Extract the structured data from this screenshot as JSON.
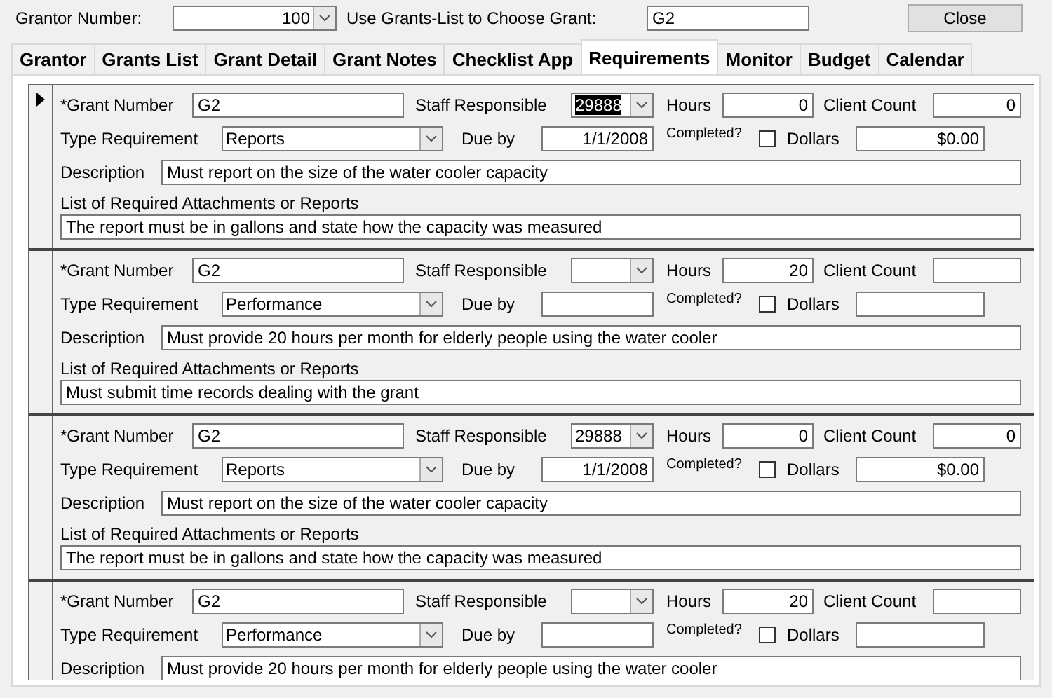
{
  "header": {
    "grantor_label": "Grantor Number:",
    "grantor_value": "100",
    "grant_label": "Use Grants-List to Choose Grant:",
    "grant_value": "G2",
    "close_button": "Close"
  },
  "tabs": [
    {
      "label": "Grantor",
      "selected": false
    },
    {
      "label": "Grants List",
      "selected": false
    },
    {
      "label": "Grant Detail",
      "selected": false
    },
    {
      "label": "Grant Notes",
      "selected": false
    },
    {
      "label": "Checklist App",
      "selected": false
    },
    {
      "label": "Requirements",
      "selected": true
    },
    {
      "label": "Monitor",
      "selected": false
    },
    {
      "label": "Budget",
      "selected": false
    },
    {
      "label": "Calendar",
      "selected": false
    }
  ],
  "records": [
    {
      "current": true,
      "grant_number_label": "*Grant Number",
      "grant_number": "G2",
      "staff_label": "Staff Responsible",
      "staff": "29888",
      "staff_focused": true,
      "hours_label": "Hours",
      "hours": "0",
      "client_count_label": "Client Count",
      "client_count": "0",
      "type_label": "Type Requirement",
      "type": "Reports",
      "due_by_label": "Due by",
      "due_by": "1/1/2008",
      "completed_label": "Completed?",
      "completed": false,
      "dollars_label": "Dollars",
      "dollars": "$0.00",
      "description_label": "Description",
      "description": "Must report on the size of the water cooler capacity",
      "attachments_label": "List of Required Attachments or Reports",
      "attachments": "The report must be in gallons and state how the capacity was measured"
    },
    {
      "current": false,
      "grant_number_label": "*Grant Number",
      "grant_number": "G2",
      "staff_label": "Staff Responsible",
      "hours_label": "Hours",
      "hours": "20",
      "client_count_label": "Client Count",
      "type_label": "Type Requirement",
      "type": "Performance",
      "due_by_label": "Due by",
      "completed_label": "Completed?",
      "completed": false,
      "dollars_label": "Dollars",
      "description_label": "Description",
      "description": "Must provide 20 hours per month for elderly people using the water cooler",
      "attachments_label": "List of Required Attachments or Reports",
      "attachments": "Must submit time records dealing with the grant"
    },
    {
      "current": false,
      "grant_number_label": "*Grant Number",
      "grant_number": "G2",
      "staff_label": "Staff Responsible",
      "staff": "29888",
      "staff_focused": false,
      "hours_label": "Hours",
      "hours": "0",
      "client_count_label": "Client Count",
      "client_count": "0",
      "type_label": "Type Requirement",
      "type": "Reports",
      "due_by_label": "Due by",
      "due_by": "1/1/2008",
      "completed_label": "Completed?",
      "completed": false,
      "dollars_label": "Dollars",
      "dollars": "$0.00",
      "description_label": "Description",
      "description": "Must report on the size of the water cooler capacity",
      "attachments_label": "List of Required Attachments or Reports",
      "attachments": "The report must be in gallons and state how the capacity was measured"
    },
    {
      "current": false,
      "grant_number_label": "*Grant Number",
      "grant_number": "G2",
      "staff_label": "Staff Responsible",
      "hours_label": "Hours",
      "hours": "20",
      "client_count_label": "Client Count",
      "type_label": "Type Requirement",
      "type": "Performance",
      "due_by_label": "Due by",
      "completed_label": "Completed?",
      "completed": false,
      "dollars_label": "Dollars",
      "description_label": "Description",
      "description": "Must provide 20 hours per month for elderly people using the water cooler"
    }
  ]
}
